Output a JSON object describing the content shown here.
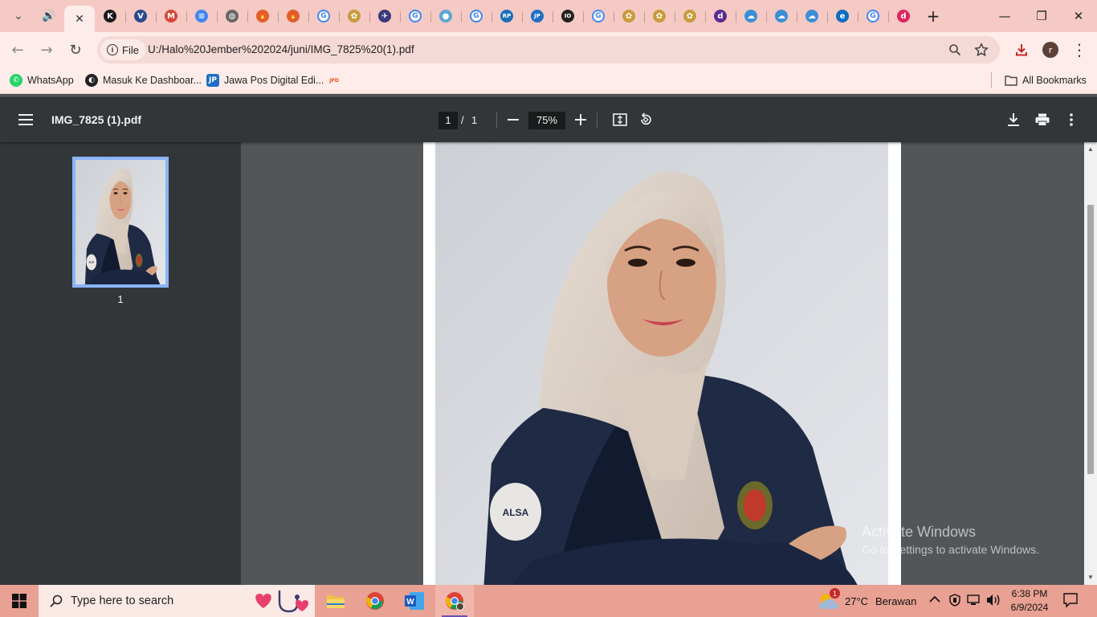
{
  "browser": {
    "tabs": [
      {
        "icon": "tab-list-chevron-icon",
        "label": "⌄",
        "color": "#5f6368"
      },
      {
        "icon": "speaker-icon",
        "label": "🔊",
        "color": "#5f6368"
      },
      {
        "icon": "close-tab-icon",
        "label": "✕",
        "color": "#333333"
      },
      {
        "icon": "k-favicon",
        "label": "K",
        "color": "#1a1a1a"
      },
      {
        "icon": "v-favicon",
        "label": "V",
        "color": "#2b4a8c"
      },
      {
        "icon": "gmail-favicon",
        "label": "M",
        "color": "#d44638"
      },
      {
        "icon": "docs-favicon",
        "label": "≡",
        "color": "#4285f4"
      },
      {
        "icon": "globe-favicon",
        "label": "◍",
        "color": "#666666"
      },
      {
        "icon": "fire-favicon",
        "label": "🔥",
        "color": "#e35d2b"
      },
      {
        "icon": "fire-favicon",
        "label": "🔥",
        "color": "#e35d2b"
      },
      {
        "icon": "google-favicon",
        "label": "G",
        "color": "#4285f4"
      },
      {
        "icon": "emblem-favicon",
        "label": "✿",
        "color": "#c89b3c"
      },
      {
        "icon": "plane-favicon",
        "label": "✈",
        "color": "#3a3a7a"
      },
      {
        "icon": "google-favicon",
        "label": "G",
        "color": "#4285f4"
      },
      {
        "icon": "earth-favicon",
        "label": "●",
        "color": "#5ba6d6"
      },
      {
        "icon": "google-favicon",
        "label": "G",
        "color": "#4285f4"
      },
      {
        "icon": "rp-favicon",
        "label": "RP",
        "color": "#1b6fb8"
      },
      {
        "icon": "jp-favicon",
        "label": "JP",
        "color": "#1f6fc5"
      },
      {
        "icon": "io-favicon",
        "label": "IO",
        "color": "#222222"
      },
      {
        "icon": "google-favicon",
        "label": "G",
        "color": "#4285f4"
      },
      {
        "icon": "emblem-favicon",
        "label": "✿",
        "color": "#c89b3c"
      },
      {
        "icon": "emblem-favicon",
        "label": "✿",
        "color": "#c89b3c"
      },
      {
        "icon": "emblem-favicon",
        "label": "✿",
        "color": "#c89b3c"
      },
      {
        "icon": "d-favicon",
        "label": "d",
        "color": "#5b2c8f"
      },
      {
        "icon": "cloud-favicon",
        "label": "☁",
        "color": "#3a8fd6"
      },
      {
        "icon": "cloud-favicon",
        "label": "☁",
        "color": "#3a8fd6"
      },
      {
        "icon": "cloud-favicon",
        "label": "☁",
        "color": "#3a8fd6"
      },
      {
        "icon": "edge-favicon",
        "label": "e",
        "color": "#0c6ebf"
      },
      {
        "icon": "google-favicon",
        "label": "G",
        "color": "#4285f4"
      },
      {
        "icon": "d-favicon",
        "label": "d",
        "color": "#e0245e"
      }
    ],
    "new_tab": "+",
    "window": {
      "minimize": "—",
      "restore": "❐",
      "close": "✕"
    },
    "nav": {
      "back": "←",
      "forward": "→",
      "reload": "↻"
    },
    "site_chip": "File",
    "url": "U:/Halo%20Jember%202024/juni/IMG_7825%20(1).pdf",
    "omnibox_icons": {
      "zoom": "🔍",
      "star": "☆"
    },
    "profile_initial": "r",
    "download_icon": "⤓",
    "menu_icon": "⋮"
  },
  "bookmarks": {
    "items": [
      {
        "label": "WhatsApp",
        "icon": "whatsapp-icon",
        "glyph": "✆",
        "color": "#25d366"
      },
      {
        "label": "Masuk Ke Dashboar...",
        "icon": "dashboard-icon",
        "glyph": "◐",
        "color": "#222222"
      },
      {
        "label": "Jawa Pos Digital Edi...",
        "icon": "jawapos-icon",
        "glyph": "JP",
        "color": "#1f6fc5"
      },
      {
        "label": "",
        "icon": "jpd-icon",
        "glyph": "JPD",
        "color": "#e94e1b"
      }
    ],
    "all_bookmarks": "All Bookmarks"
  },
  "pdf": {
    "filename": "IMG_7825 (1).pdf",
    "current_page": "1",
    "page_separator": "/",
    "total_pages": "1",
    "zoom": "75%",
    "thumbnail_label": "1",
    "icons": {
      "menu": "☰",
      "zoom_out": "−",
      "zoom_in": "+",
      "fit": "⊡",
      "rotate": "⟲",
      "download": "⤓",
      "print": "⎙",
      "more": "⋮"
    }
  },
  "watermark": {
    "title": "Activate Windows",
    "subtitle": "Go to Settings to activate Windows."
  },
  "taskbar": {
    "search_placeholder": "Type here to search",
    "weather_temp": "27°C",
    "weather_desc": "Berawan",
    "weather_badge": "1",
    "time": "6:38 PM",
    "date": "6/9/2024",
    "apps": [
      {
        "name": "file-explorer",
        "color": "#f0c24b"
      },
      {
        "name": "chrome",
        "color": "#4285f4"
      },
      {
        "name": "word",
        "color": "#2b579a"
      },
      {
        "name": "chrome-profile",
        "color": "#4285f4"
      }
    ]
  },
  "colors": {
    "tab_strip": "#f5c9c4",
    "toolbar": "#fdecea",
    "pdf_bar": "#323639",
    "pdf_bg": "#525659",
    "thumb_highlight": "#8ab4f8",
    "taskbar": "#e8a193"
  }
}
